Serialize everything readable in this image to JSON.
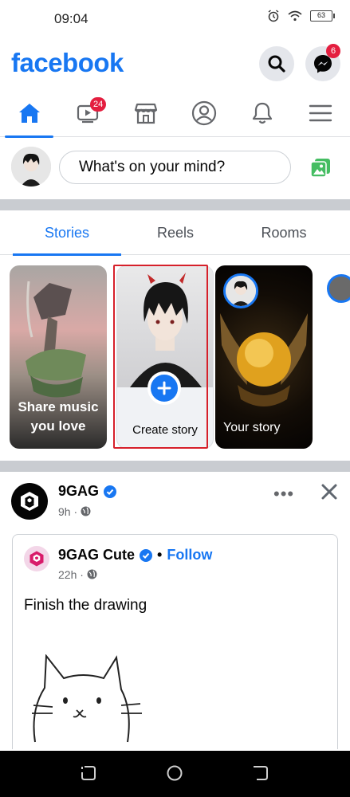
{
  "status_bar": {
    "time": "09:04",
    "battery": "63"
  },
  "header": {
    "logo": "facebook",
    "messenger_badge": "6"
  },
  "nav": {
    "items": [
      {
        "name": "home",
        "icon": "home-icon",
        "active": true
      },
      {
        "name": "watch",
        "icon": "video-icon",
        "badge": "24"
      },
      {
        "name": "marketplace",
        "icon": "store-icon"
      },
      {
        "name": "profile",
        "icon": "profile-icon"
      },
      {
        "name": "notifications",
        "icon": "bell-icon"
      },
      {
        "name": "menu",
        "icon": "hamburger-icon"
      }
    ],
    "watch_badge": "24"
  },
  "composer": {
    "placeholder": "What's on your mind?"
  },
  "tabs": [
    {
      "label": "Stories",
      "active": true
    },
    {
      "label": "Reels"
    },
    {
      "label": "Rooms"
    }
  ],
  "stories": {
    "share_music": "Share music you love",
    "create_story": "Create story",
    "your_story": "Your story"
  },
  "post": {
    "page_name": "9GAG",
    "time": "9h",
    "shared": {
      "page_name": "9GAG Cute",
      "follow_label": "Follow",
      "time": "22h",
      "text": "Finish the drawing"
    }
  },
  "colors": {
    "brand": "#1877f2",
    "badge": "#e41e3f",
    "highlight": "#d6202a"
  }
}
